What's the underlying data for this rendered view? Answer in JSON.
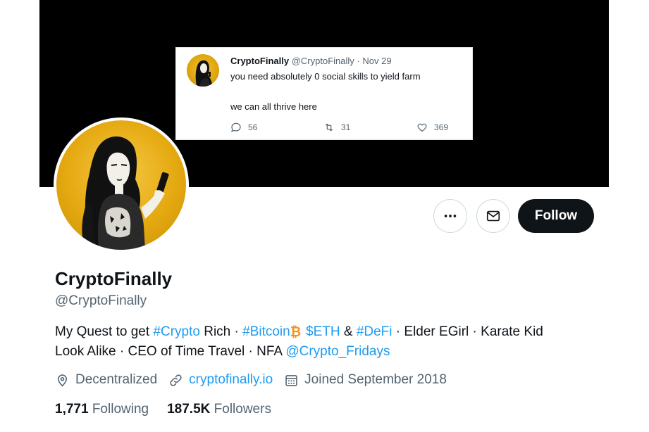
{
  "tweet": {
    "name": "CryptoFinally",
    "handle": "@CryptoFinally",
    "separator": "·",
    "date": "Nov 29",
    "line1": "you need absolutely 0 social skills to yield farm",
    "line2": "we can all thrive here",
    "replies": "56",
    "retweets": "31",
    "likes": "369"
  },
  "actions": {
    "follow_label": "Follow",
    "more_icon": "more-dots-icon",
    "message_icon": "envelope-icon"
  },
  "profile": {
    "name": "CryptoFinally",
    "handle": "@CryptoFinally",
    "bio": {
      "t1": "My Quest to get ",
      "crypto_tag": "#Crypto",
      "t2": " Rich · ",
      "bitcoin_tag": "#Bitcoin",
      "bitcoin_symbol": "₿",
      "eth_tag": "$ETH",
      "t3": " & ",
      "defi_tag": "#DeFi",
      "t4": " · Elder EGirl · Karate Kid",
      "t5": "Look Alike · CEO of Time Travel · NFA ",
      "mention": "@Crypto_Fridays"
    },
    "location": "Decentralized",
    "website": "cryptofinally.io",
    "joined": "Joined September 2018",
    "following_count": "1,771",
    "following_label": "Following",
    "followers_count": "187.5K",
    "followers_label": "Followers"
  },
  "colors": {
    "link": "#1d9bf0",
    "text": "#0f1419",
    "muted": "#536471",
    "banner": "#000000",
    "avatar_gold": "#e5a911",
    "bitcoin_orange": "#f7931a"
  }
}
